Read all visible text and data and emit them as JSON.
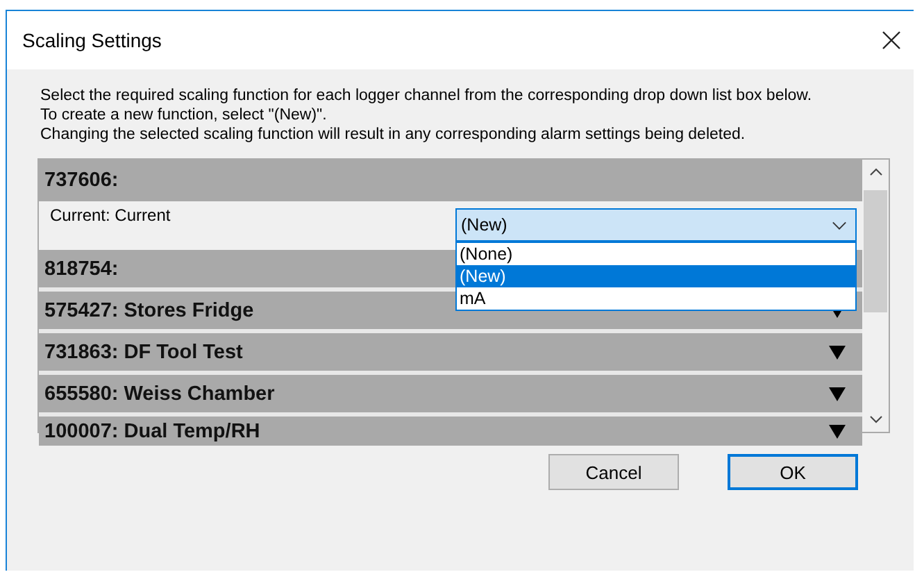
{
  "window": {
    "title": "Scaling Settings"
  },
  "instructions": [
    "Select the required scaling function for each logger channel from the corresponding drop down list box below. To create a new function, select \"(New)\".",
    "Changing the selected scaling function will result in any corresponding alarm settings being deleted."
  ],
  "loggers": [
    {
      "title": "737606:",
      "expanded": true,
      "channels": [
        {
          "label": "Current: Current",
          "value": "(New)",
          "open": true,
          "options": [
            {
              "label": "(None)",
              "selected": false
            },
            {
              "label": "(New)",
              "selected": true
            },
            {
              "label": "mA",
              "selected": false
            }
          ]
        }
      ]
    },
    {
      "title": "818754:",
      "expanded": false
    },
    {
      "title": "575427: Stores Fridge",
      "expanded": false
    },
    {
      "title": "731863: DF Tool Test",
      "expanded": false
    },
    {
      "title": "655580: Weiss Chamber",
      "expanded": false
    },
    {
      "title": "100007: Dual Temp/RH",
      "expanded": false
    }
  ],
  "buttons": [
    {
      "label": "Cancel",
      "default": false
    },
    {
      "label": "OK",
      "default": true
    }
  ]
}
